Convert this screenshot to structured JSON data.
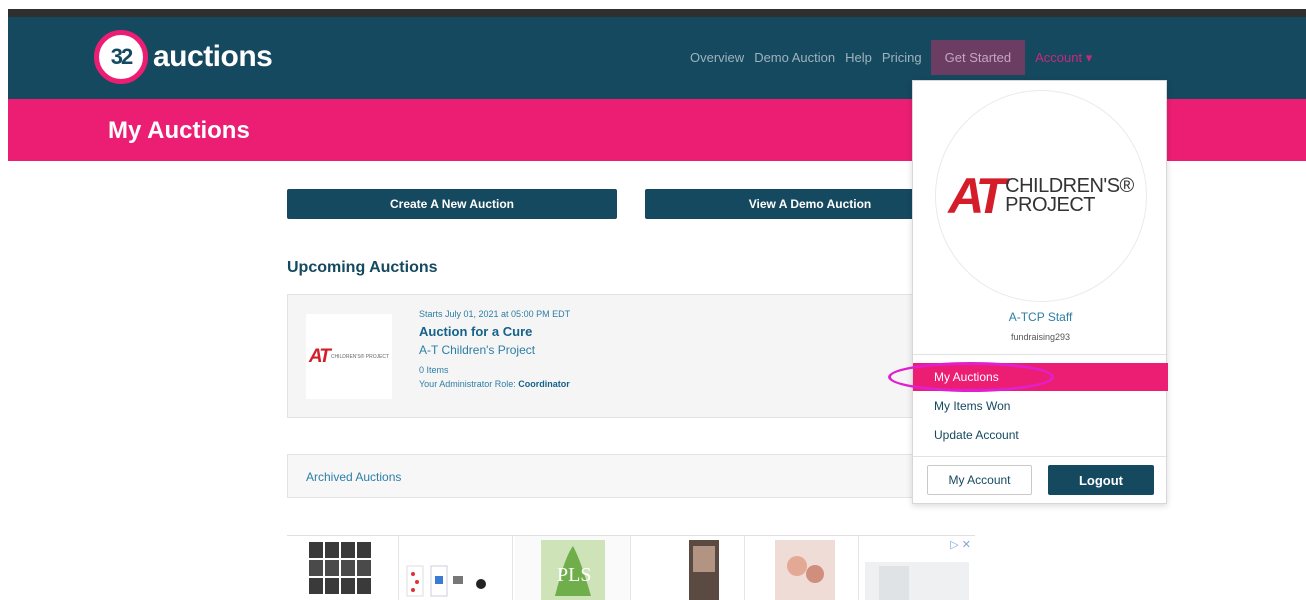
{
  "brand": {
    "logo_number": "32",
    "logo_text": "auctions",
    "accent": "#ec1e74",
    "primary": "#15495f"
  },
  "nav": {
    "links": [
      "Overview",
      "Demo Auction",
      "Help",
      "Pricing"
    ],
    "get_started": "Get Started",
    "account": "Account ▾"
  },
  "page": {
    "title": "My Auctions"
  },
  "actions": {
    "create": "Create A New Auction",
    "demo": "View A Demo Auction"
  },
  "upcoming": {
    "title": "Upcoming Auctions",
    "auction": {
      "date": "Starts July 01, 2021 at 05:00 PM EDT",
      "name": "Auction for a Cure",
      "org": "A-T Children's Project",
      "items": "0 Items",
      "role_label": "Your Administrator Role:",
      "role": "Coordinator",
      "logo_mark": "AT",
      "logo_text": "CHILDREN'S® PROJECT"
    }
  },
  "archived": {
    "label": "Archived Auctions"
  },
  "ads": {
    "choice_icon": "▷ ✕"
  },
  "dropdown": {
    "org_mark": "AT",
    "org_line1": "CHILDREN'S®",
    "org_line2": "PROJECT",
    "name": "A-TCP Staff",
    "username": "fundraising293",
    "items": [
      "My Auctions",
      "My Items Won",
      "Update Account"
    ],
    "my_account": "My Account",
    "logout": "Logout"
  }
}
